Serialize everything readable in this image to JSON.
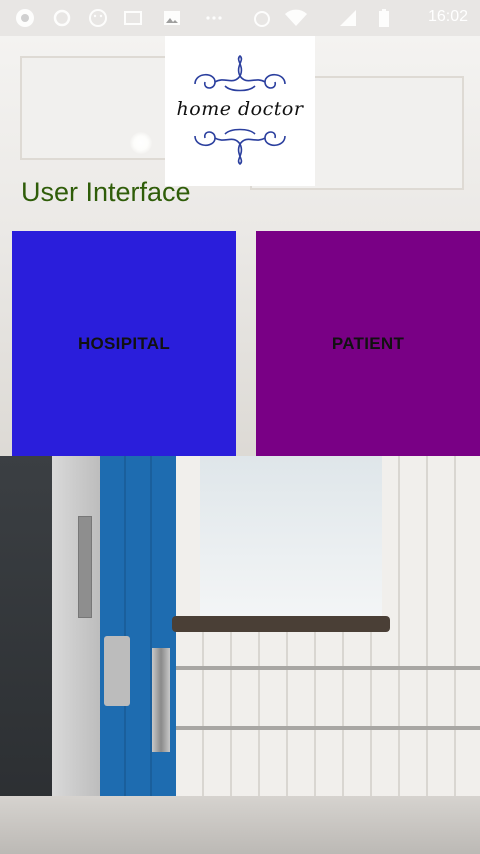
{
  "status_bar": {
    "time": "16:02",
    "icons": [
      "chrome-icon",
      "circle-icon",
      "face-icon",
      "gallery-icon",
      "image-icon",
      "more-icon",
      "alarm-icon",
      "wifi-icon",
      "signal-icon",
      "battery-icon"
    ]
  },
  "logo": {
    "text": "home doctor"
  },
  "page": {
    "title": "User Interface"
  },
  "tiles": {
    "hospital": {
      "label": "HOSIPITAL",
      "color": "#2a1edb"
    },
    "patient": {
      "label": "PATIENT",
      "color": "#790085"
    }
  },
  "colors": {
    "title": "#2f5d09"
  }
}
